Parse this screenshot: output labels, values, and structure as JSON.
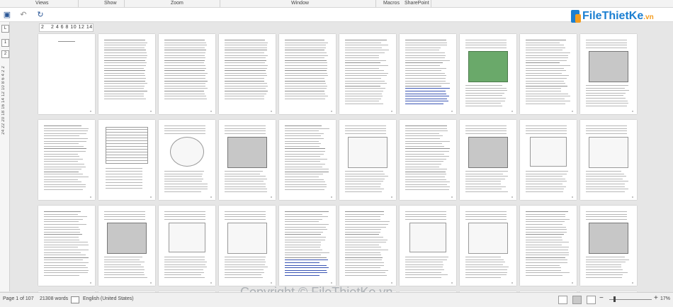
{
  "ribbon": {
    "groups": [
      "Views",
      "Show",
      "Zoom",
      "Window",
      "Macros",
      "SharePoint"
    ]
  },
  "qat": {
    "undo_icon": "undo-icon",
    "redo_icon": "redo-icon",
    "refresh_icon": "refresh-icon"
  },
  "logo": {
    "text": "FileThietKe",
    "suffix": ".vn"
  },
  "vertical_ruler": {
    "view_label": "L",
    "numbers_text": "24 22 20 18 16 14 12 10 8 6 4 2 2",
    "buttons": [
      "L",
      "1",
      "2"
    ]
  },
  "horizontal_ruler": {
    "mark": "2",
    "numbers_text": "2 4 6 8 10 12 14"
  },
  "status": {
    "page": "Page 1 of 107",
    "words": "21308 words",
    "language": "English (United States)",
    "zoom": "17%"
  },
  "watermark": "Copyright © FileThietKe.vn",
  "colors": {
    "brand_blue": "#1b7fd1",
    "brand_orange": "#f39c1f",
    "link_blue": "#3a55b4"
  },
  "pages_count_visible": 40
}
